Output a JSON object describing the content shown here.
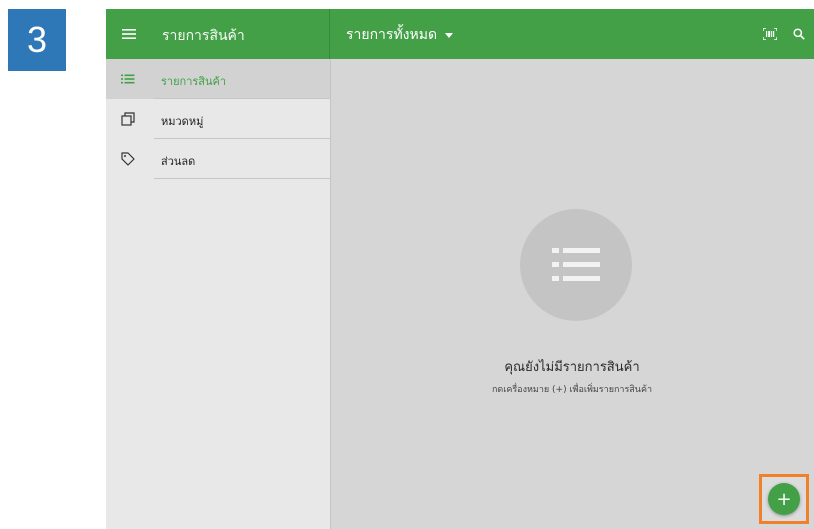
{
  "step_number": "3",
  "toolbar": {
    "title": "รายการสินค้า",
    "filter_label": "รายการทั้งหมด"
  },
  "sidebar": {
    "items": [
      {
        "label": "รายการสินค้า",
        "icon": "list-icon",
        "active": true
      },
      {
        "label": "หมวดหมู่",
        "icon": "category-icon",
        "active": false
      },
      {
        "label": "ส่วนลด",
        "icon": "tag-icon",
        "active": false
      }
    ]
  },
  "empty_state": {
    "title": "คุณยังไม่มีรายการสินค้า",
    "hint": "กดเครื่องหมาย (+) เพื่อเพิ่มรายการสินค้า",
    "icon": "list-icon"
  },
  "fab": {
    "label": "+",
    "icon": "add-icon"
  },
  "colors": {
    "primary": "#43a047",
    "highlight": "#f0802a",
    "step_badge": "#2f78b8",
    "background": "#d6d6d6"
  }
}
